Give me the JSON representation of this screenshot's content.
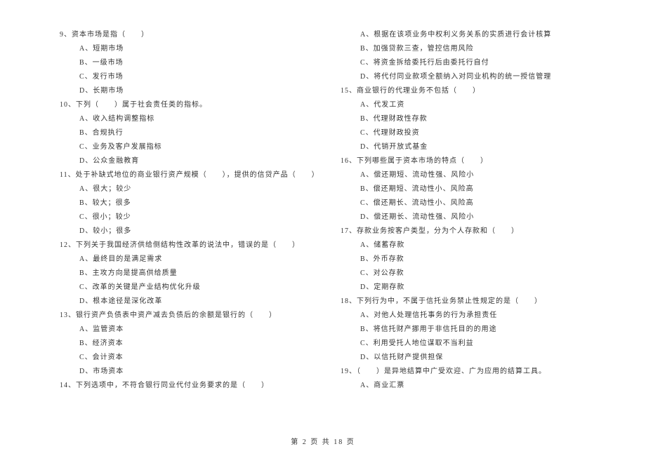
{
  "left_column": [
    {
      "type": "question",
      "text": "9、资本市场是指（　　）"
    },
    {
      "type": "option",
      "text": "A、短期市场"
    },
    {
      "type": "option",
      "text": "B、一级市场"
    },
    {
      "type": "option",
      "text": "C、发行市场"
    },
    {
      "type": "option",
      "text": "D、长期市场"
    },
    {
      "type": "question",
      "text": "10、下列（　　）属于社会责任类的指标。"
    },
    {
      "type": "option",
      "text": "A、收入结构调整指标"
    },
    {
      "type": "option",
      "text": "B、合规执行"
    },
    {
      "type": "option",
      "text": "C、业务及客户发展指标"
    },
    {
      "type": "option",
      "text": "D、公众金融教育"
    },
    {
      "type": "question",
      "text": "11、处于补缺式地位的商业银行资产规模（　　），提供的信贷产品（　　）"
    },
    {
      "type": "option",
      "text": "A、很大；较少"
    },
    {
      "type": "option",
      "text": "B、较大；很多"
    },
    {
      "type": "option",
      "text": "C、很小；较少"
    },
    {
      "type": "option",
      "text": "D、较小；很多"
    },
    {
      "type": "question",
      "text": "12、下列关于我国经济供给侧结构性改革的说法中，错误的是（　　）"
    },
    {
      "type": "option",
      "text": "A、最终目的是满足需求"
    },
    {
      "type": "option",
      "text": "B、主攻方向是提高供给质量"
    },
    {
      "type": "option",
      "text": "C、改革的关键是产业结构优化升级"
    },
    {
      "type": "option",
      "text": "D、根本途径是深化改革"
    },
    {
      "type": "question",
      "text": "13、银行资产负债表中资产减去负债后的余额是银行的（　　）"
    },
    {
      "type": "option",
      "text": "A、监管资本"
    },
    {
      "type": "option",
      "text": "B、经济资本"
    },
    {
      "type": "option",
      "text": "C、会计资本"
    },
    {
      "type": "option",
      "text": "D、市场资本"
    },
    {
      "type": "question",
      "text": "14、下列选项中，不符合银行同业代付业务要求的是（　　）"
    }
  ],
  "right_column": [
    {
      "type": "option",
      "text": "A、根据在该项业务中权利义务关系的实质进行会计核算"
    },
    {
      "type": "option",
      "text": "B、加强贷款三查，管控信用风险"
    },
    {
      "type": "option",
      "text": "C、将资金拆给委托行后由委托行自付"
    },
    {
      "type": "option",
      "text": "D、将代付同业款项全额纳入对同业机构的统一授信管理"
    },
    {
      "type": "question",
      "text": "15、商业银行的代理业务不包括（　　）"
    },
    {
      "type": "option",
      "text": "A、代发工资"
    },
    {
      "type": "option",
      "text": "B、代理财政性存款"
    },
    {
      "type": "option",
      "text": "C、代理财政投资"
    },
    {
      "type": "option",
      "text": "D、代销开放式基金"
    },
    {
      "type": "question",
      "text": "16、下列哪些属于资本市场的特点（　　）"
    },
    {
      "type": "option",
      "text": "A、偿还期短、流动性强、风险小"
    },
    {
      "type": "option",
      "text": "B、偿还期短、流动性小、风险高"
    },
    {
      "type": "option",
      "text": "C、偿还期长、流动性小、风险高"
    },
    {
      "type": "option",
      "text": "D、偿还期长、流动性强、风险小"
    },
    {
      "type": "question",
      "text": "17、存款业务按客户类型，分为个人存款和（　　）"
    },
    {
      "type": "option",
      "text": "A、储蓄存款"
    },
    {
      "type": "option",
      "text": "B、外币存款"
    },
    {
      "type": "option",
      "text": "C、对公存款"
    },
    {
      "type": "option",
      "text": "D、定期存款"
    },
    {
      "type": "question",
      "text": "18、下列行为中，不属于信托业务禁止性规定的是（　　）"
    },
    {
      "type": "option",
      "text": "A、对他人处理信托事务的行为承担责任"
    },
    {
      "type": "option",
      "text": "B、将信托财产挪用于非信托目的的用途"
    },
    {
      "type": "option",
      "text": "C、利用受托人地位谋取不当利益"
    },
    {
      "type": "option",
      "text": "D、以信托财产提供担保"
    },
    {
      "type": "question",
      "text": "19、（　　）是异地结算中广受欢迎、广为应用的结算工具。"
    },
    {
      "type": "option",
      "text": "A、商业汇票"
    }
  ],
  "footer": "第 2 页 共 18 页"
}
